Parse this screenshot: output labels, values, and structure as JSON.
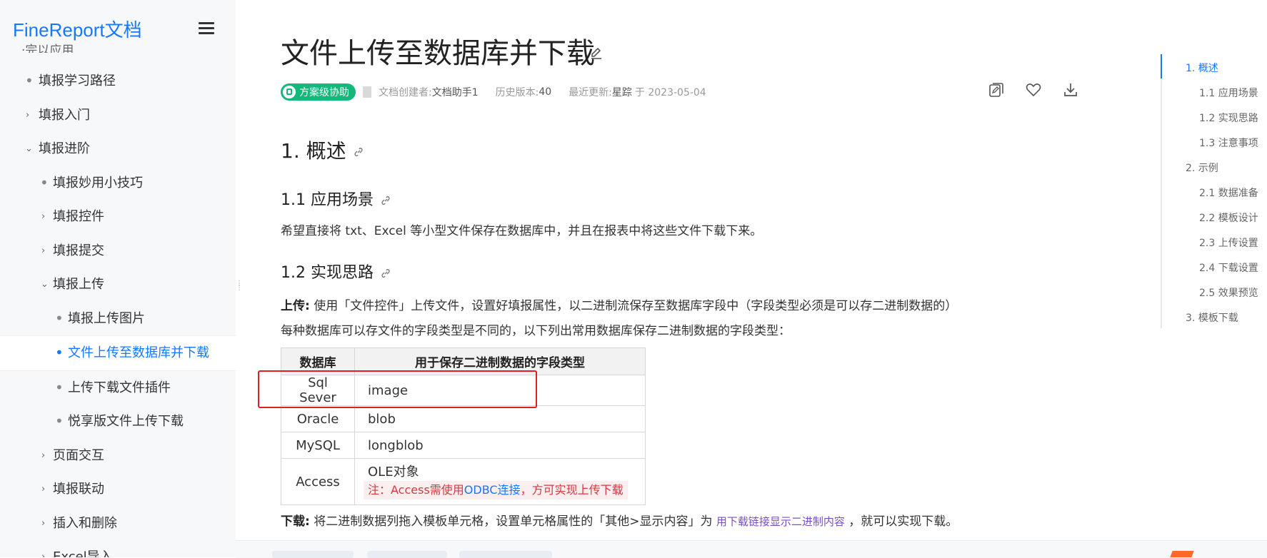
{
  "sidebar": {
    "brand": "FineReport文档",
    "cut_item": "·完以应用",
    "items": [
      {
        "label": "填报学习路径",
        "marker": "•",
        "level": 1
      },
      {
        "label": "填报入门",
        "marker": "›",
        "level": 1
      },
      {
        "label": "填报进阶",
        "marker": "⌄",
        "level": 1
      },
      {
        "label": "填报妙用小技巧",
        "marker": "•",
        "level": 2
      },
      {
        "label": "填报控件",
        "marker": "›",
        "level": 2
      },
      {
        "label": "填报提交",
        "marker": "›",
        "level": 2
      },
      {
        "label": "填报上传",
        "marker": "⌄",
        "level": 2
      },
      {
        "label": "填报上传图片",
        "marker": "•",
        "level": 3
      },
      {
        "label": "文件上传至数据库并下载",
        "marker": "•",
        "level": 3,
        "active": true
      },
      {
        "label": "上传下载文件插件",
        "marker": "•",
        "level": 3
      },
      {
        "label": "悦享版文件上传下载",
        "marker": "•",
        "level": 3
      },
      {
        "label": "页面交互",
        "marker": "›",
        "level": 2
      },
      {
        "label": "填报联动",
        "marker": "›",
        "level": 2
      },
      {
        "label": "插入和删除",
        "marker": "›",
        "level": 2
      },
      {
        "label": "Excel导入",
        "marker": "›",
        "level": 2
      }
    ]
  },
  "article": {
    "title": "文件上传至数据库并下载",
    "badge": "方案级协助",
    "meta": {
      "creator_label": "文档创建者:",
      "creator": "文档助手1",
      "version_label": "历史版本:",
      "version": "40",
      "updated_label": "最近更新:",
      "updated_by": "星踪",
      "updated_on": "于 2023-05-04"
    },
    "h1": "1. 概述",
    "h1_1": "1.1 应用场景",
    "p_scene": "希望直接将 txt、Excel 等小型文件保存在数据库中，并且在报表中将这些文件下载下来。",
    "h1_2": "1.2 实现思路",
    "upload_label": "上传:",
    "upload_text": "使用「文件控件」上传文件，设置好填报属性，以二进制流保存至数据库字段中（字段类型必须是可以存二进制数据的）",
    "p_types": "每种数据库可以存文件的字段类型是不同的，以下列出常用数据库保存二进制数据的字段类型：",
    "table": {
      "headers": [
        "数据库",
        "用于保存二进制数据的字段类型"
      ],
      "rows": [
        {
          "db": "Sql Sever",
          "type": "image"
        },
        {
          "db": "Oracle",
          "type": "blob"
        },
        {
          "db": "MySQL",
          "type": "longblob"
        },
        {
          "db": "Access",
          "type": "OLE对象"
        }
      ],
      "note_prefix": "注：Access需使用",
      "note_link": "ODBC连接",
      "note_suffix": "，方可实现上传下载"
    },
    "download_label": "下载:",
    "download_text_1": "将二进制数据列拖入模板单元格，设置单元格属性的「其他>显示内容」为",
    "download_link": "用下载链接显示二进制内容",
    "download_text_2": "，就可以实现下载。"
  },
  "toc": [
    {
      "label": "1. 概述",
      "active": true
    },
    {
      "label": "1.1 应用场景"
    },
    {
      "label": "1.2 实现思路"
    },
    {
      "label": "1.3 注意事项"
    },
    {
      "label": "2. 示例"
    },
    {
      "label": "2.1 数据准备"
    },
    {
      "label": "2.2 模板设计"
    },
    {
      "label": "2.3 上传设置"
    },
    {
      "label": "2.4 下载设置"
    },
    {
      "label": "2.5 效果预览"
    },
    {
      "label": "3. 模板下载"
    }
  ],
  "colors": {
    "accent": "#1677ff",
    "badge": "#13b87a",
    "highlight": "#e02020",
    "note": "#d9363e"
  }
}
